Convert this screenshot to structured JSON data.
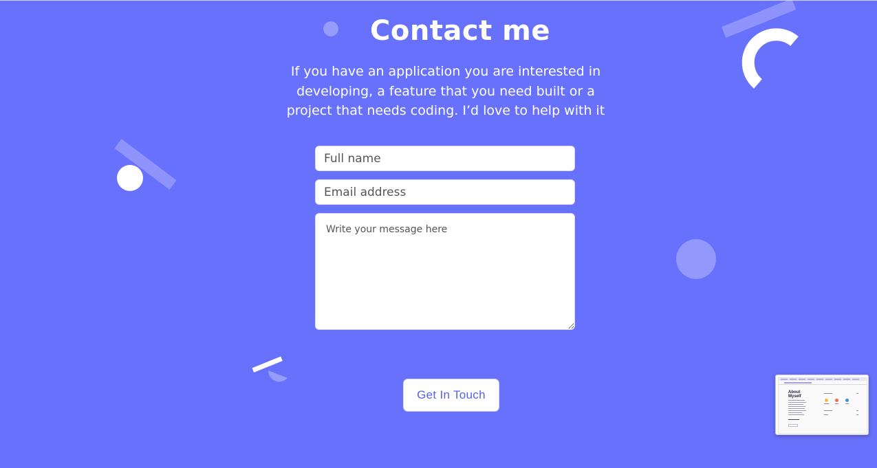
{
  "page": {
    "title": "Contact me",
    "subtitle": "If you have an application you are interested in developing, a feature that you need built or a project that needs coding. I’d love to help with it"
  },
  "form": {
    "name_placeholder": "Full name",
    "email_placeholder": "Email address",
    "message_placeholder": "Write your message here",
    "submit_label": "Get In Touch"
  },
  "preview_thumbnail": {
    "heading": "About Myself"
  },
  "colors": {
    "background": "#6871fb",
    "text": "#ffffff",
    "button_text": "#5661e8"
  }
}
